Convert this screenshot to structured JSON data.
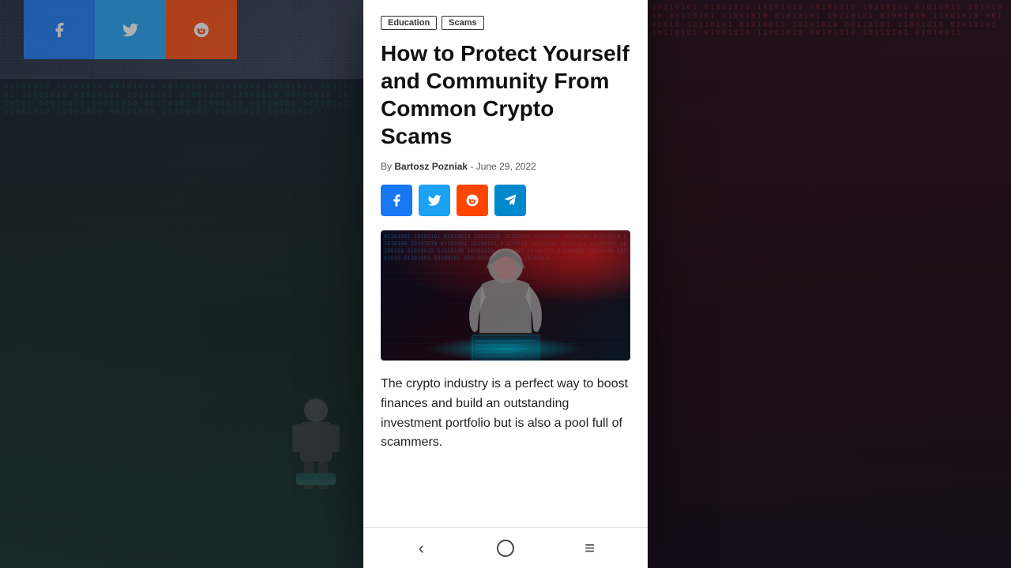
{
  "background": {
    "left_color": "#1a2030",
    "right_color": "#2a1015"
  },
  "bg_social_icons": [
    {
      "label": "f",
      "color": "#1877f2",
      "name": "facebook"
    },
    {
      "label": "t",
      "color": "#1da1f2",
      "name": "twitter"
    },
    {
      "label": "r",
      "color": "#ff4500",
      "name": "reddit"
    }
  ],
  "tags": [
    {
      "label": "Education"
    },
    {
      "label": "Scams"
    }
  ],
  "article": {
    "title": "How to Protect Yourself and Community From Common Crypto Scams",
    "byline_prefix": "By",
    "author": "Bartosz Pozniak",
    "date": "June 29, 2022",
    "body": "The crypto industry is a perfect way to boost finances and build an outstanding investment portfolio but is also a pool full of scammers."
  },
  "social_share": [
    {
      "icon": "f",
      "name": "facebook",
      "color": "#1877f2"
    },
    {
      "icon": "t",
      "name": "twitter",
      "color": "#1da1f2"
    },
    {
      "icon": "r",
      "name": "reddit",
      "color": "#ff4500"
    },
    {
      "icon": "✈",
      "name": "telegram",
      "color": "#0088cc"
    }
  ],
  "nav": {
    "back_symbol": "‹",
    "home_symbol": "○",
    "menu_symbol": "≡"
  }
}
